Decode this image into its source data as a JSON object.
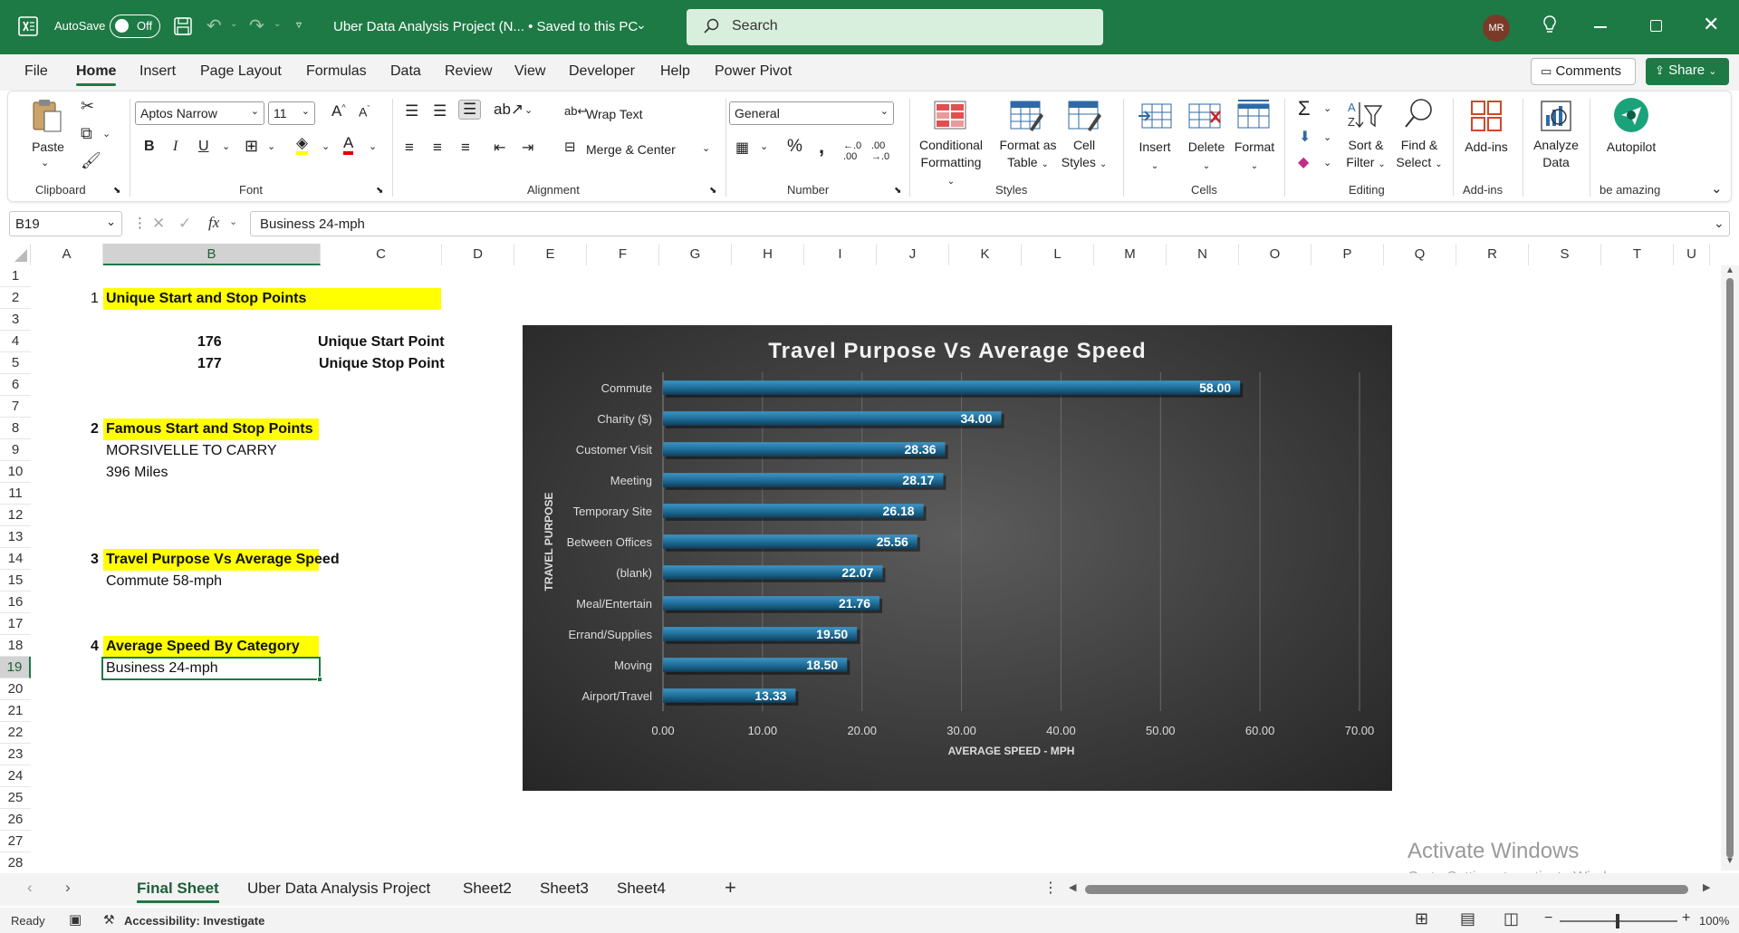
{
  "titlebar": {
    "autosave_label": "AutoSave",
    "autosave_state": "Off",
    "doc_title": "Uber Data Analysis Project (N... • Saved to this PC",
    "search_placeholder": "Search",
    "avatar_initials": "MR"
  },
  "menu": {
    "tabs": [
      "File",
      "Home",
      "Insert",
      "Page Layout",
      "Formulas",
      "Data",
      "Review",
      "View",
      "Developer",
      "Help",
      "Power Pivot"
    ],
    "comments": "Comments",
    "share": "Share"
  },
  "ribbon": {
    "clipboard": {
      "paste": "Paste",
      "group": "Clipboard"
    },
    "font": {
      "name": "Aptos Narrow",
      "size": "11",
      "group": "Font"
    },
    "alignment": {
      "wrap": "Wrap Text",
      "merge": "Merge & Center",
      "group": "Alignment"
    },
    "number": {
      "format": "General",
      "group": "Number"
    },
    "styles": {
      "conditional_1": "Conditional",
      "conditional_2": "Formatting",
      "format_table_1": "Format as",
      "format_table_2": "Table",
      "cell_styles_1": "Cell",
      "cell_styles_2": "Styles",
      "group": "Styles"
    },
    "cells": {
      "insert": "Insert",
      "delete": "Delete",
      "format": "Format",
      "group": "Cells"
    },
    "editing": {
      "sort_1": "Sort &",
      "sort_2": "Filter",
      "find_1": "Find &",
      "find_2": "Select",
      "group": "Editing"
    },
    "addins": {
      "label": "Add-ins",
      "group": "Add-ins"
    },
    "analyze": {
      "label_1": "Analyze",
      "label_2": "Data"
    },
    "autopilot": {
      "label": "Autopilot",
      "group": "be amazing"
    }
  },
  "formula_bar": {
    "name_box": "B19",
    "fx": "fx",
    "content": "Business 24-mph"
  },
  "grid": {
    "columns": [
      "A",
      "B",
      "C",
      "D",
      "E",
      "F",
      "G",
      "H",
      "I",
      "J",
      "K",
      "L",
      "M",
      "N",
      "O",
      "P",
      "Q",
      "R",
      "S",
      "T",
      "U"
    ],
    "rows": [
      "1",
      "2",
      "3",
      "4",
      "5",
      "6",
      "7",
      "8",
      "9",
      "10",
      "11",
      "12",
      "13",
      "14",
      "15",
      "16",
      "17",
      "18",
      "19",
      "20",
      "21",
      "22",
      "23",
      "24",
      "25",
      "26",
      "27",
      "28"
    ],
    "cells": {
      "a2": "1",
      "b2": "Unique Start and Stop Points",
      "b4": "176",
      "c4": "Unique Start Point",
      "b5": "177",
      "c5": "Unique Stop Point",
      "a8": "2",
      "b8": "Famous Start and Stop Points",
      "b9": "MORSIVELLE TO CARRY",
      "b10": "396 Miles",
      "a14": "3",
      "b14": "Travel Purpose Vs Average Speed",
      "b15": "Commute 58-mph",
      "a18": "4",
      "b18": "Average Speed By Category",
      "b19": "Business 24-mph"
    }
  },
  "chart_data": {
    "type": "bar",
    "orientation": "horizontal",
    "title": "Travel Purpose Vs Average Speed",
    "xlabel": "AVERAGE SPEED - MPH",
    "ylabel": "TRAVEL PURPOSE",
    "categories": [
      "Commute",
      "Charity ($)",
      "Customer Visit",
      "Meeting",
      "Temporary Site",
      "Between Offices",
      "(blank)",
      "Meal/Entertain",
      "Errand/Supplies",
      "Moving",
      "Airport/Travel"
    ],
    "values": [
      58.0,
      34.0,
      28.36,
      28.17,
      26.18,
      25.56,
      22.07,
      21.76,
      19.5,
      18.5,
      13.33
    ],
    "value_labels": [
      "58.00",
      "34.00",
      "28.36",
      "28.17",
      "26.18",
      "25.56",
      "22.07",
      "21.76",
      "19.50",
      "18.50",
      "13.33"
    ],
    "xlim": [
      0,
      70
    ],
    "xticks": [
      "0.00",
      "10.00",
      "20.00",
      "30.00",
      "40.00",
      "50.00",
      "60.00",
      "70.00"
    ],
    "grid": true,
    "bar_color": "#1f6f9a"
  },
  "sheets": {
    "tabs": [
      "Final Sheet",
      "Uber Data Analysis Project",
      "Sheet2",
      "Sheet3",
      "Sheet4"
    ],
    "active": "Final Sheet"
  },
  "status": {
    "ready": "Ready",
    "accessibility": "Accessibility: Investigate",
    "zoom": "100%",
    "watermark_1": "Activate Windows",
    "watermark_2": "Go to Settings to activate Windows."
  }
}
